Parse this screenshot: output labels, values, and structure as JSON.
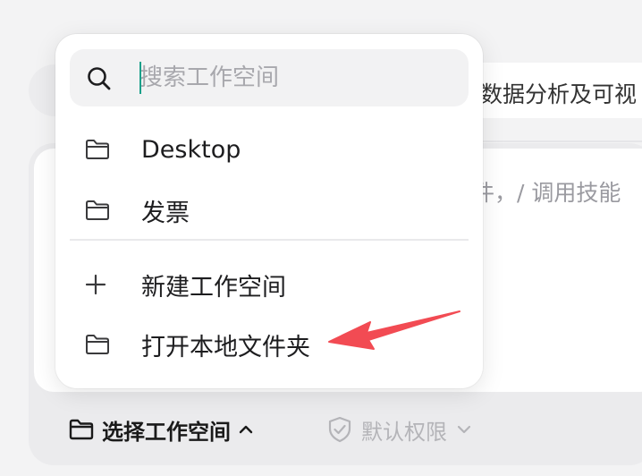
{
  "background": {
    "chip_text": "数据分析及可视",
    "composer_hint": "件，/ 调用技能"
  },
  "bottom_bar": {
    "workspace_label": "选择工作空间",
    "permission_label": "默认权限"
  },
  "dropdown": {
    "search": {
      "placeholder": "搜索工作空间",
      "value": ""
    },
    "workspaces": [
      {
        "label": "Desktop",
        "icon": "folder-icon"
      },
      {
        "label": "发票",
        "icon": "folder-icon"
      }
    ],
    "actions": [
      {
        "label": "新建工作空间",
        "icon": "plus-icon"
      },
      {
        "label": "打开本地文件夹",
        "icon": "folder-icon"
      }
    ]
  },
  "colors": {
    "annotation_arrow": "#f24b53",
    "caret": "#1aa08a",
    "accent_text": "#1a1a1a",
    "muted_text": "#b4b4b8"
  }
}
